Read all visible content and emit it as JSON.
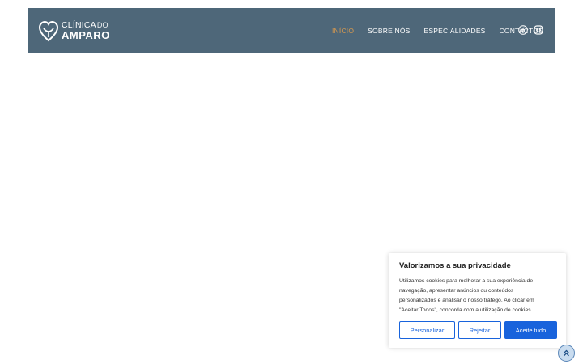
{
  "brand": {
    "line1_a": "CLÍNICA",
    "line1_b": "DO",
    "line2": "AMPARO",
    "icon": "heart-hands-logo-icon"
  },
  "nav": {
    "items": [
      {
        "label": "INÍCIO",
        "active": true
      },
      {
        "label": "SOBRE NÓS",
        "active": false
      },
      {
        "label": "ESPECIALIDADES",
        "active": false
      },
      {
        "label": "CONTACTOS",
        "active": false
      }
    ]
  },
  "social": {
    "icons": [
      "facebook-icon",
      "instagram-icon"
    ]
  },
  "cookie": {
    "title": "Valorizamos a sua privacidade",
    "text": "Utilizamos cookies para melhorar a sua experiência de navegação, apresentar anúncios ou conteúdos personalizados e analisar o nosso tráfego. Ao clicar em \"Aceitar Todos\", concorda com a utilização de cookies.",
    "buttons": {
      "customize": "Personalizar",
      "reject": "Rejeitar",
      "accept": "Aceite tudo"
    }
  },
  "scroll_top": {
    "icon": "double-chevron-up-icon"
  },
  "colors": {
    "header_bg": "#4e6779",
    "nav_active": "#d99a4e",
    "accent": "#1863dc"
  }
}
